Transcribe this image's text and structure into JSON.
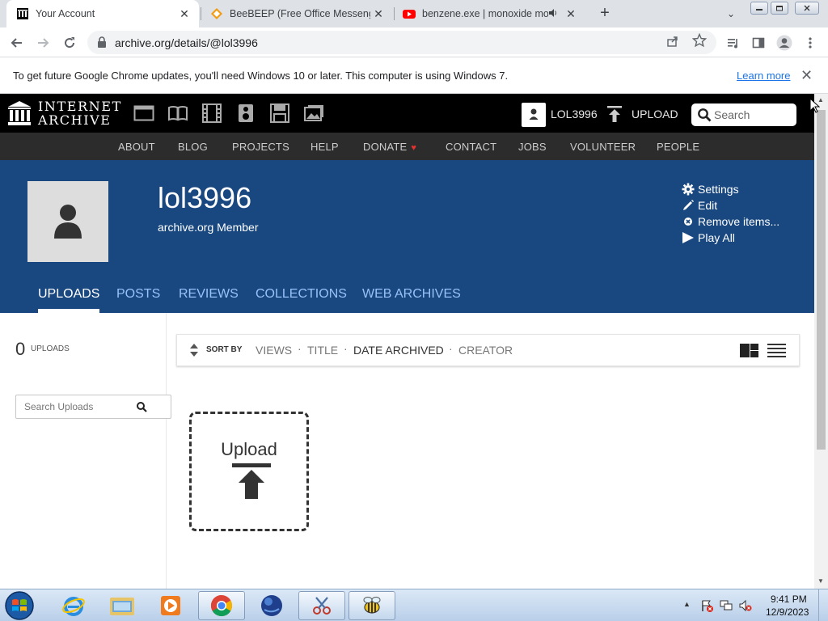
{
  "browser": {
    "tabs": [
      {
        "title": "Your Account",
        "active": true
      },
      {
        "title": "BeeBEEP (Free Office Messenger)",
        "active": false
      },
      {
        "title": "benzene.exe | monoxide mo",
        "active": false
      }
    ],
    "close_glyph": "✕",
    "new_tab_glyph": "+",
    "tab_search_glyph": "⌄",
    "url": "archive.org/details/@lol3996",
    "info_message": "To get future Google Chrome updates, you'll need Windows 10 or later. This computer is using Windows 7.",
    "info_link": "Learn more"
  },
  "ia": {
    "logo_line1": "INTERNET",
    "logo_line2": "ARCHIVE",
    "user_label": "LOL3996",
    "upload_label": "UPLOAD",
    "search_placeholder": "Search",
    "subnav": [
      "ABOUT",
      "BLOG",
      "PROJECTS",
      "HELP",
      "DONATE",
      "CONTACT",
      "JOBS",
      "VOLUNTEER",
      "PEOPLE"
    ],
    "donate_heart": "♥",
    "media_icons": [
      "web-icon",
      "texts-icon",
      "video-icon",
      "audio-icon",
      "software-icon",
      "images-icon"
    ]
  },
  "profile": {
    "username": "lol3996",
    "member_label": "archive.org Member",
    "actions": [
      {
        "label": "Settings",
        "icon": "gear-icon"
      },
      {
        "label": "Edit",
        "icon": "pencil-icon"
      },
      {
        "label": "Remove items...",
        "icon": "remove-icon"
      },
      {
        "label": "Play All",
        "icon": "play-icon"
      }
    ],
    "tabs": [
      "UPLOADS",
      "POSTS",
      "REVIEWS",
      "COLLECTIONS",
      "WEB ARCHIVES"
    ],
    "active_tab": "UPLOADS"
  },
  "uploads": {
    "count": "0",
    "count_label": "UPLOADS",
    "search_placeholder": "Search Uploads",
    "sort_by_label": "SORT BY",
    "sort_options": [
      "VIEWS",
      "TITLE",
      "DATE ARCHIVED",
      "CREATOR"
    ],
    "active_sort": "DATE ARCHIVED",
    "tile_label": "Upload"
  },
  "taskbar": {
    "time": "9:41 PM",
    "date": "12/9/2023",
    "tray_expand_glyph": "▲",
    "apps": [
      "internet-explorer-icon",
      "file-explorer-icon",
      "media-player-icon",
      "chrome-icon",
      "app-globe-icon",
      "snipping-tool-icon",
      "beebeep-icon"
    ]
  },
  "colors": {
    "banner": "#194880",
    "tab_link": "#98c1f7",
    "ia_top": "#000000",
    "ia_subnav": "#2c2c2c"
  }
}
